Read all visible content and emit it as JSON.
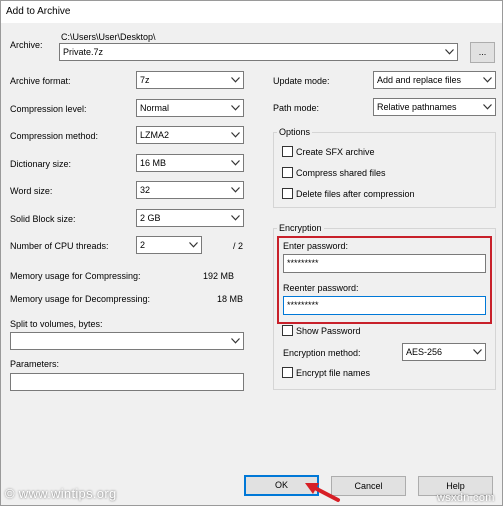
{
  "window": {
    "title": "Add to Archive"
  },
  "archive": {
    "label": "Archive:",
    "path": "C:\\Users\\User\\Desktop\\",
    "name": "Private.7z",
    "browse": "..."
  },
  "left": {
    "format_label": "Archive format:",
    "format_value": "7z",
    "level_label": "Compression level:",
    "level_value": "Normal",
    "method_label": "Compression method:",
    "method_value": "LZMA2",
    "dict_label": "Dictionary size:",
    "dict_value": "16 MB",
    "word_label": "Word size:",
    "word_value": "32",
    "solid_label": "Solid Block size:",
    "solid_value": "2 GB",
    "threads_label": "Number of CPU threads:",
    "threads_value": "2",
    "threads_total": "/ 2",
    "mem_comp_label": "Memory usage for Compressing:",
    "mem_comp_value": "192 MB",
    "mem_decomp_label": "Memory usage for Decompressing:",
    "mem_decomp_value": "18 MB",
    "split_label": "Split to volumes, bytes:",
    "split_value": "",
    "params_label": "Parameters:",
    "params_value": ""
  },
  "right": {
    "update_label": "Update mode:",
    "update_value": "Add and replace files",
    "path_label": "Path mode:",
    "path_value": "Relative pathnames",
    "options_title": "Options",
    "opt_sfx": "Create SFX archive",
    "opt_shared": "Compress shared files",
    "opt_delete": "Delete files after compression",
    "enc_title": "Encryption",
    "enter_pw_label": "Enter password:",
    "enter_pw_value": "*********",
    "reenter_pw_label": "Reenter password:",
    "reenter_pw_value": "*********",
    "show_pw": "Show Password",
    "enc_method_label": "Encryption method:",
    "enc_method_value": "AES-256",
    "enc_names": "Encrypt file names"
  },
  "buttons": {
    "ok": "OK",
    "cancel": "Cancel",
    "help": "Help"
  },
  "watermarks": {
    "left": "© www.wintips.org",
    "right": "wsxdn.com"
  },
  "colors": {
    "highlight": "#c8202a",
    "focus": "#0078d7"
  }
}
